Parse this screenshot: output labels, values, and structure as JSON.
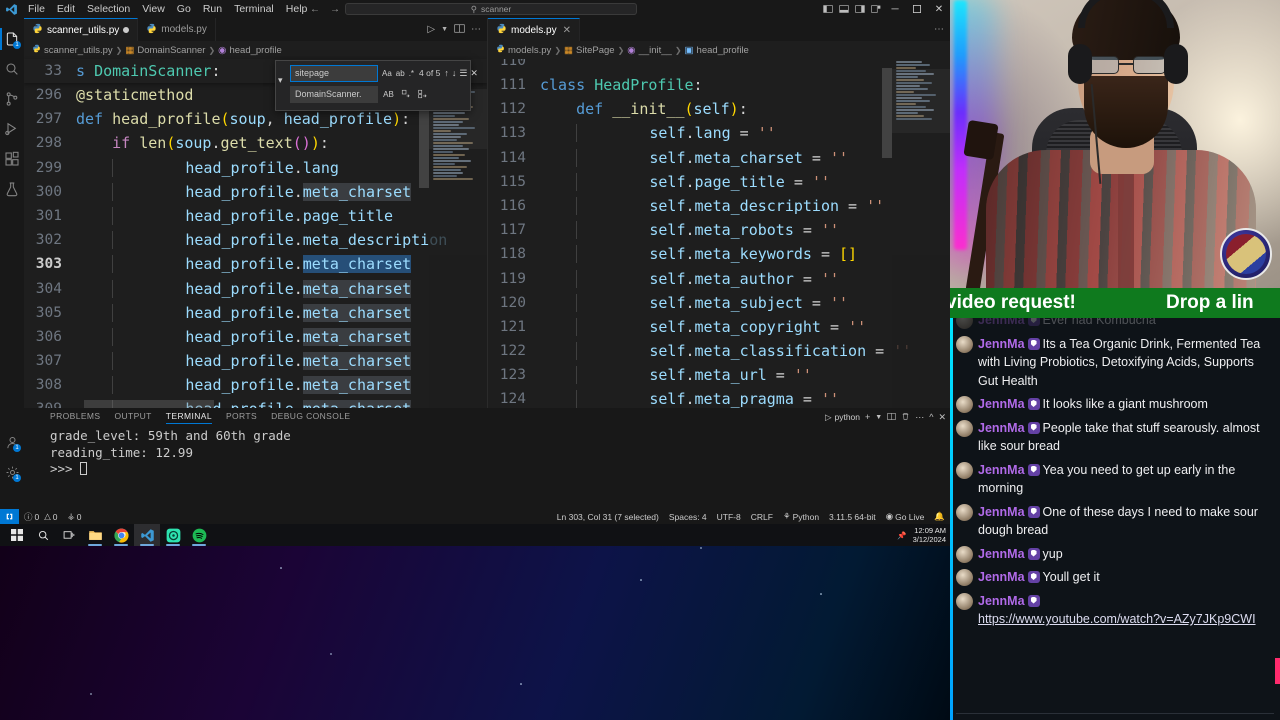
{
  "titlebar": {
    "menus": [
      "File",
      "Edit",
      "Selection",
      "View",
      "Go",
      "Run",
      "Terminal",
      "Help"
    ],
    "search_value": "scanner",
    "back_icon": "arrow-left-icon",
    "forward_icon": "arrow-right-icon",
    "layout_icons": [
      "toggle-primary-sidebar-icon",
      "toggle-panel-icon",
      "toggle-secondary-sidebar-icon",
      "customize-layout-icon"
    ],
    "window_controls": {
      "minimize": "─",
      "maximize": "⬜",
      "close": "✕"
    }
  },
  "activitybar": {
    "items": [
      {
        "name": "explorer",
        "icon": "files-icon",
        "badge": "1",
        "active": true
      },
      {
        "name": "search",
        "icon": "search-icon",
        "badge": "",
        "active": false
      },
      {
        "name": "source-control",
        "icon": "source-control-icon",
        "badge": "",
        "active": false
      },
      {
        "name": "run-and-debug",
        "icon": "run-debug-icon",
        "badge": "",
        "active": false
      },
      {
        "name": "extensions",
        "icon": "extensions-icon",
        "badge": "",
        "active": false
      },
      {
        "name": "testing",
        "icon": "beaker-icon",
        "badge": "",
        "active": false
      }
    ],
    "bottom": [
      {
        "name": "accounts",
        "icon": "account-icon",
        "badge": "1"
      },
      {
        "name": "manage",
        "icon": "gear-icon",
        "badge": "1"
      }
    ]
  },
  "editor_left": {
    "tabs": [
      {
        "label": "scanner_utils.py",
        "icon": "python-file-icon",
        "dirty": true,
        "active": true
      },
      {
        "label": "models.py",
        "icon": "python-file-icon",
        "dirty": false,
        "active": false
      }
    ],
    "breadcrumb": [
      "scanner_utils.py",
      "DomainScanner",
      "head_profile"
    ],
    "sticky_line_number": "33",
    "sticky_text": "s DomainScanner:",
    "lines": [
      {
        "num": "296",
        "text": "@staticmethod"
      },
      {
        "num": "297",
        "text": "def head_profile(soup, head_profile):"
      },
      {
        "num": "298",
        "text": "    if len(soup.get_text()):"
      },
      {
        "num": "299",
        "text": "        head_profile.lang"
      },
      {
        "num": "300",
        "text": "        head_profile.meta_charset"
      },
      {
        "num": "301",
        "text": "        head_profile.page_title"
      },
      {
        "num": "302",
        "text": "        head_profile.meta_description"
      },
      {
        "num": "303",
        "text": "        head_profile.meta_charset"
      },
      {
        "num": "304",
        "text": "        head_profile.meta_charset"
      },
      {
        "num": "305",
        "text": "        head_profile.meta_charset"
      },
      {
        "num": "306",
        "text": "        head_profile.meta_charset"
      },
      {
        "num": "307",
        "text": "        head_profile.meta_charset"
      },
      {
        "num": "308",
        "text": "        head_profile.meta_charset"
      },
      {
        "num": "309",
        "text": "        head_profile.meta_charset"
      }
    ],
    "current_line": "303"
  },
  "find_widget": {
    "find_value": "sitepage",
    "replace_value": "DomainScanner.",
    "match_count": "4 of 5",
    "find_icons": [
      "match-case-icon",
      "match-whole-word-icon",
      "use-regex-icon"
    ],
    "replace_icons": [
      "preserve-case-icon",
      "replace-icon",
      "replace-all-icon"
    ],
    "nav_icons": [
      "previous-match-icon",
      "next-match-icon",
      "find-in-selection-icon",
      "close-icon"
    ],
    "expand_icon": "chevron-down-icon"
  },
  "editor_right": {
    "tabs": [
      {
        "label": "models.py",
        "icon": "python-file-icon",
        "dirty": false,
        "active": true
      }
    ],
    "breadcrumb": [
      "models.py",
      "SitePage",
      "__init__",
      "head_profile"
    ],
    "partial_top_line": "110",
    "lines": [
      {
        "num": "111",
        "text": "class HeadProfile:"
      },
      {
        "num": "112",
        "text": "    def __init__(self):"
      },
      {
        "num": "113",
        "text": "        self.lang = ''"
      },
      {
        "num": "114",
        "text": "        self.meta_charset = ''"
      },
      {
        "num": "115",
        "text": "        self.page_title = ''"
      },
      {
        "num": "116",
        "text": "        self.meta_description = ''"
      },
      {
        "num": "117",
        "text": "        self.meta_robots = ''"
      },
      {
        "num": "118",
        "text": "        self.meta_keywords = []"
      },
      {
        "num": "119",
        "text": "        self.meta_author = ''"
      },
      {
        "num": "120",
        "text": "        self.meta_subject = ''"
      },
      {
        "num": "121",
        "text": "        self.meta_copyright = ''"
      },
      {
        "num": "122",
        "text": "        self.meta_classification = ''"
      },
      {
        "num": "123",
        "text": "        self.meta_url = ''"
      },
      {
        "num": "124",
        "text": "        self.meta_pragma = ''"
      }
    ]
  },
  "panel": {
    "tabs": [
      "PROBLEMS",
      "OUTPUT",
      "TERMINAL",
      "PORTS",
      "DEBUG CONSOLE"
    ],
    "active_tab": "TERMINAL",
    "shell_label": "python",
    "actions": [
      "new-terminal-icon",
      "chevron-down-icon",
      "split-terminal-icon",
      "kill-terminal-icon",
      "more-actions-icon",
      "maximize-panel-icon",
      "close-panel-icon"
    ],
    "output_lines": [
      "grade_level: 59th and 60th grade",
      "reading_time: 12.99",
      "",
      ">>> "
    ]
  },
  "statusbar": {
    "remote_icon": "remote-indicator-icon",
    "problems": "0",
    "warnings": "0",
    "ports": "0",
    "cursor": "Ln 303, Col 31 (7 selected)",
    "indentation": "Spaces: 4",
    "encoding": "UTF-8",
    "eol": "CRLF",
    "language": "Python",
    "interpreter": "3.11.5 64-bit",
    "golive": "Go Live",
    "bell_icon": "bell-icon"
  },
  "taskbar": {
    "items": [
      {
        "name": "start-button",
        "icon": "windows-logo-icon",
        "running": false,
        "active": false
      },
      {
        "name": "search-button",
        "icon": "search-icon",
        "running": false,
        "active": false
      },
      {
        "name": "task-view-button",
        "icon": "task-view-icon",
        "running": false,
        "active": false
      },
      {
        "name": "file-explorer",
        "icon": "folder-icon",
        "running": true,
        "active": false
      },
      {
        "name": "chrome",
        "icon": "chrome-icon",
        "running": true,
        "active": false
      },
      {
        "name": "vscode",
        "icon": "vscode-icon",
        "running": true,
        "active": true
      },
      {
        "name": "obs",
        "icon": "obs-icon",
        "running": true,
        "active": false
      },
      {
        "name": "spotify",
        "icon": "spotify-icon",
        "running": true,
        "active": false
      }
    ],
    "tray_icon": "pin-icon",
    "clock_time": "12:09 AM",
    "clock_date": "3/12/2024"
  },
  "stream": {
    "ticker_left": "video request!",
    "ticker_right": "Drop a lin",
    "webcam_alt": "streamer-webcam"
  },
  "chat": {
    "messages": [
      {
        "user": "JennMa",
        "badge": "moderator-badge",
        "text": "Ever had Kombucha",
        "link": "",
        "faded": true
      },
      {
        "user": "JennMa",
        "badge": "moderator-badge",
        "text": "Its a Tea Organic Drink, Fermented Tea with Living Probiotics, Detoxifying Acids, Supports Gut Health",
        "link": ""
      },
      {
        "user": "JennMa",
        "badge": "moderator-badge",
        "text": "It looks like a giant mushroom",
        "link": ""
      },
      {
        "user": "JennMa",
        "badge": "moderator-badge",
        "text": "People take that stuff searously. almost like sour bread",
        "link": ""
      },
      {
        "user": "JennMa",
        "badge": "moderator-badge",
        "text": "Yea you need to get up early in the morning",
        "link": ""
      },
      {
        "user": "JennMa",
        "badge": "moderator-badge",
        "text": "One of these days I need to make sour dough bread",
        "link": ""
      },
      {
        "user": "JennMa",
        "badge": "moderator-badge",
        "text": "yup",
        "link": ""
      },
      {
        "user": "JennMa",
        "badge": "moderator-badge",
        "text": "Youll get it",
        "link": ""
      },
      {
        "user": "JennMa",
        "badge": "moderator-badge",
        "text": "",
        "link": "https://www.youtube.com/watch?v=AZy7JKp9CWI"
      }
    ]
  },
  "colors": {
    "accent": "#0078d4",
    "editor_bg": "#1e1e1e",
    "twitch_purple": "#b06ae8",
    "ticker_green": "#0f7a1e"
  }
}
